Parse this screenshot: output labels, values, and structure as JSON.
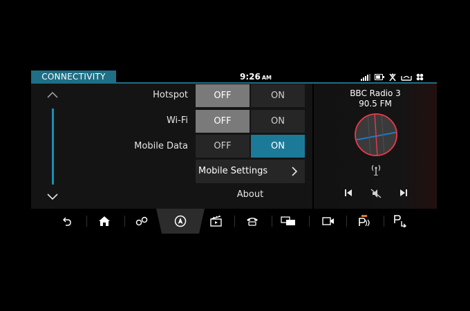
{
  "status_bar": {
    "section_title": "CONNECTIVITY",
    "time": "9:26",
    "ampm": "AM",
    "icons": [
      "signal-icon",
      "battery-icon",
      "seat-heating-icon",
      "dashboard-icon",
      "fan-icon"
    ]
  },
  "settings": {
    "rows": [
      {
        "label": "Hotspot",
        "off_label": "OFF",
        "on_label": "ON",
        "selected": "OFF"
      },
      {
        "label": "Wi-Fi",
        "off_label": "OFF",
        "on_label": "ON",
        "selected": "OFF"
      },
      {
        "label": "Mobile Data",
        "off_label": "OFF",
        "on_label": "ON",
        "selected": "ON"
      }
    ],
    "mobile_settings_label": "Mobile Settings",
    "about_label": "About"
  },
  "media": {
    "station": "BBC Radio 3",
    "frequency": "90.5 FM"
  },
  "nav": {
    "items": [
      "back-icon",
      "home-icon",
      "connectivity-icon",
      "navigation-icon",
      "media-icon",
      "phone-icon",
      "screen-icon",
      "camera-icon",
      "parking-icon",
      "park-assist-icon"
    ],
    "active": "navigation-icon"
  },
  "colors": {
    "accent": "#1c7a98",
    "tab": "#1f6f86",
    "selected_off": "#7a7a7a",
    "dial_ring": "#e03a4a"
  }
}
